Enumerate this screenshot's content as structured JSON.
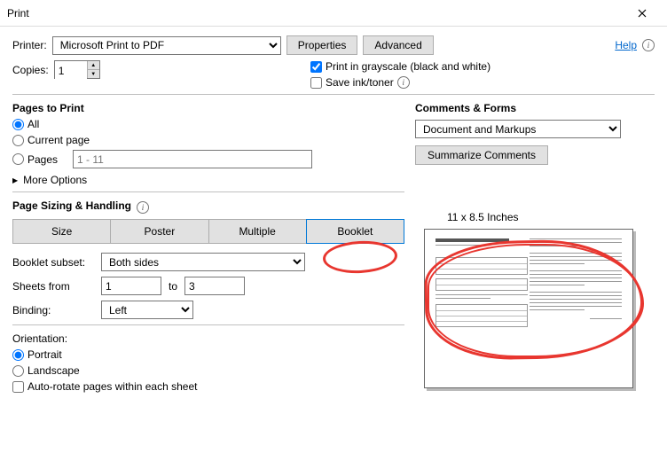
{
  "window": {
    "title": "Print"
  },
  "top": {
    "printer_label": "Printer:",
    "printer_value": "Microsoft Print to PDF",
    "properties": "Properties",
    "advanced": "Advanced",
    "help": "Help",
    "copies_label": "Copies:",
    "copies_value": "1",
    "grayscale": "Print in grayscale (black and white)",
    "save_ink": "Save ink/toner"
  },
  "pages": {
    "title": "Pages to Print",
    "all": "All",
    "current": "Current page",
    "pages": "Pages",
    "range_placeholder": "1 - 11",
    "more": "More Options"
  },
  "comments": {
    "title": "Comments & Forms",
    "select_value": "Document and Markups",
    "summarize": "Summarize Comments"
  },
  "sizing": {
    "title": "Page Sizing & Handling",
    "size": "Size",
    "poster": "Poster",
    "multiple": "Multiple",
    "booklet": "Booklet",
    "subset_label": "Booklet subset:",
    "subset_value": "Both sides",
    "sheets_from": "Sheets from",
    "sheets_from_val": "1",
    "to": "to",
    "sheets_to_val": "3",
    "binding_label": "Binding:",
    "binding_value": "Left"
  },
  "orientation": {
    "title": "Orientation:",
    "portrait": "Portrait",
    "landscape": "Landscape",
    "autorotate": "Auto-rotate pages within each sheet"
  },
  "preview": {
    "dimensions": "11 x 8.5 Inches"
  }
}
